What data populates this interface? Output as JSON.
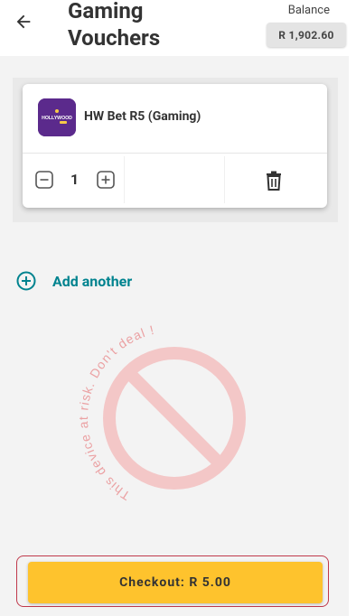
{
  "header": {
    "title": "Gaming Vouchers",
    "balance_label": "Balance",
    "balance_value": "R 1,902.60"
  },
  "voucher": {
    "logo_text": "HOLLYWOOD",
    "product_name": "HW Bet R5 (Gaming)",
    "quantity": "1"
  },
  "actions": {
    "add_another_label": "Add another",
    "checkout_label": "Checkout: R 5.00"
  },
  "watermark": {
    "text": "This device at risk. Don't deal !"
  },
  "colors": {
    "accent_teal": "#00838f",
    "checkout_yellow": "#fec32d",
    "logo_purple": "#5b2a8c",
    "watermark_red": "#e8898b"
  }
}
